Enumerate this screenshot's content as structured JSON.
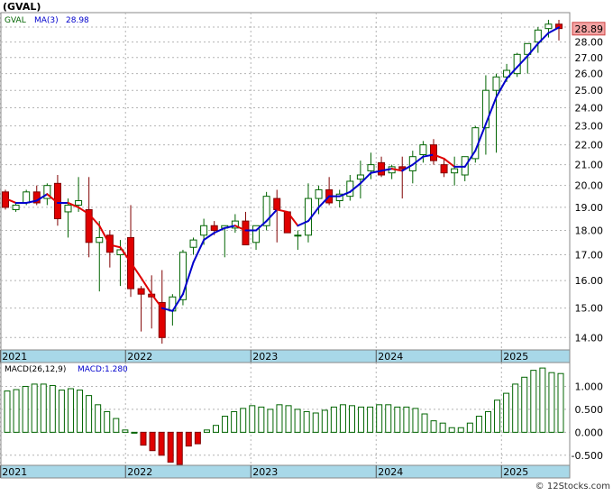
{
  "title": "(GVAL)",
  "watermark": "© 12Stocks.com",
  "colors": {
    "up_fill": "#ffffff",
    "up_stroke": "#006400",
    "down_fill": "#e00000",
    "down_stroke": "#800000",
    "ma_up": "#0000cc",
    "ma_down": "#e00000",
    "macd_pos_stroke": "#006400",
    "macd_neg_fill": "#e00000",
    "grid": "#b4b4b4",
    "axis_band": "#a8d8e8",
    "price_tag_bg": "#f4a4a4"
  },
  "chart_data": [
    {
      "type": "candlestick",
      "legend": {
        "symbol": "GVAL",
        "ma_label": "MA(3)",
        "ma_value": "28.98"
      },
      "last_price_label": "28.89",
      "ylim": [
        13.6,
        30.0
      ],
      "log_scale": true,
      "grid": true,
      "y_ticks": [
        14,
        15,
        16,
        17,
        18,
        19,
        20,
        21,
        22,
        23,
        24,
        25,
        26,
        27,
        28,
        29
      ],
      "y_tick_labels": [
        "14.00",
        "15.00",
        "16.00",
        "17.00",
        "18.00",
        "19.00",
        "20.00",
        "21.00",
        "22.00",
        "23.00",
        "24.00",
        "25.00",
        "26.00",
        "27.00",
        "28.00",
        "29.00"
      ],
      "x_labels": [
        "2021",
        "2022",
        "2023",
        "2024",
        "2025"
      ],
      "x_label_index": [
        0,
        12,
        24,
        36,
        48
      ],
      "ohlc": [
        [
          19.7,
          19.8,
          18.9,
          19.0
        ],
        [
          18.9,
          19.2,
          18.8,
          19.1
        ],
        [
          19.2,
          19.8,
          19.1,
          19.7
        ],
        [
          19.7,
          20.0,
          19.1,
          19.2
        ],
        [
          19.4,
          20.1,
          19.1,
          20.0
        ],
        [
          20.1,
          20.5,
          18.2,
          18.5
        ],
        [
          18.8,
          19.4,
          17.7,
          19.1
        ],
        [
          19.1,
          20.4,
          18.8,
          19.3
        ],
        [
          18.9,
          20.4,
          16.9,
          17.5
        ],
        [
          17.5,
          18.4,
          15.6,
          17.7
        ],
        [
          17.8,
          18.0,
          16.5,
          17.1
        ],
        [
          17.0,
          17.6,
          15.8,
          17.2
        ],
        [
          17.7,
          19.1,
          15.4,
          15.7
        ],
        [
          15.7,
          15.8,
          14.2,
          15.5
        ],
        [
          15.5,
          16.2,
          14.3,
          15.4
        ],
        [
          15.2,
          16.4,
          13.8,
          14.0
        ],
        [
          14.9,
          15.5,
          14.4,
          15.4
        ],
        [
          15.3,
          17.2,
          15.1,
          17.1
        ],
        [
          17.3,
          17.7,
          17.0,
          17.6
        ],
        [
          17.8,
          18.5,
          17.4,
          18.2
        ],
        [
          18.2,
          18.4,
          17.8,
          18.0
        ],
        [
          18.1,
          18.2,
          16.9,
          18.2
        ],
        [
          18.1,
          18.7,
          17.9,
          18.4
        ],
        [
          18.4,
          18.8,
          17.7,
          17.4
        ],
        [
          17.5,
          18.1,
          17.2,
          18.2
        ],
        [
          18.2,
          19.7,
          18.0,
          19.5
        ],
        [
          19.4,
          19.8,
          17.5,
          18.9
        ],
        [
          18.8,
          18.7,
          17.9,
          17.9
        ],
        [
          17.8,
          18.0,
          17.2,
          17.8
        ],
        [
          17.8,
          20.1,
          17.5,
          19.4
        ],
        [
          19.4,
          20.0,
          18.7,
          19.8
        ],
        [
          19.8,
          20.4,
          19.1,
          19.2
        ],
        [
          19.3,
          19.8,
          19.0,
          19.6
        ],
        [
          19.5,
          20.5,
          19.3,
          20.2
        ],
        [
          20.3,
          21.2,
          19.4,
          20.5
        ],
        [
          20.7,
          21.6,
          20.3,
          21.0
        ],
        [
          21.1,
          21.4,
          20.4,
          20.5
        ],
        [
          20.6,
          21.0,
          20.3,
          20.9
        ],
        [
          20.9,
          21.4,
          19.4,
          20.8
        ],
        [
          20.7,
          21.7,
          20.1,
          21.4
        ],
        [
          21.5,
          22.2,
          21.1,
          22.0
        ],
        [
          22.0,
          22.3,
          21.0,
          21.2
        ],
        [
          21.0,
          21.3,
          20.4,
          20.6
        ],
        [
          20.6,
          21.4,
          20.0,
          20.8
        ],
        [
          20.5,
          21.4,
          20.2,
          21.4
        ],
        [
          21.3,
          23.0,
          21.1,
          22.9
        ],
        [
          22.9,
          25.9,
          21.5,
          25.0
        ],
        [
          25.0,
          26.0,
          21.6,
          25.8
        ],
        [
          25.8,
          26.6,
          25.5,
          26.2
        ],
        [
          26.0,
          27.3,
          25.8,
          27.2
        ],
        [
          27.2,
          27.9,
          26.0,
          27.9
        ],
        [
          28.0,
          29.0,
          27.3,
          28.8
        ],
        [
          28.9,
          29.5,
          28.3,
          29.2
        ],
        [
          29.2,
          29.5,
          28.1,
          28.9
        ]
      ],
      "ma3": [
        19.4,
        19.2,
        19.2,
        19.3,
        19.6,
        19.2,
        19.2,
        19.0,
        18.7,
        18.2,
        17.4,
        17.3,
        16.7,
        16.1,
        15.5,
        15.0,
        14.9,
        15.5,
        16.7,
        17.6,
        17.9,
        18.1,
        18.2,
        18.0,
        18.0,
        18.4,
        18.9,
        18.8,
        18.2,
        18.4,
        19.0,
        19.5,
        19.5,
        19.7,
        20.1,
        20.6,
        20.7,
        20.8,
        20.7,
        21.0,
        21.4,
        21.5,
        21.3,
        20.9,
        20.9,
        21.7,
        23.1,
        24.6,
        25.7,
        26.4,
        27.1,
        27.9,
        28.6,
        28.98
      ],
      "ma_trend_down": [
        true,
        true,
        false,
        false,
        false,
        true,
        false,
        true,
        true,
        true,
        true,
        true,
        true,
        true,
        true,
        true,
        false,
        false,
        false,
        false,
        false,
        false,
        false,
        true,
        false,
        false,
        false,
        true,
        true,
        false,
        false,
        false,
        false,
        false,
        false,
        false,
        false,
        false,
        true,
        false,
        false,
        false,
        true,
        true,
        false,
        false,
        false,
        false,
        false,
        false,
        false,
        false,
        false,
        false
      ]
    },
    {
      "type": "bar",
      "legend": {
        "label": "MACD(26,12,9)",
        "value_label": "MACD:1.280"
      },
      "ylim": [
        -0.72,
        1.52
      ],
      "grid": true,
      "y_ticks": [
        -0.5,
        0,
        0.5,
        1.0
      ],
      "y_tick_labels": [
        "-0.500",
        "0.000",
        "0.500",
        "1.000"
      ],
      "x_labels": [
        "2021",
        "2022",
        "2023",
        "2024",
        "2025"
      ],
      "values": [
        0.9,
        0.93,
        1.0,
        1.05,
        1.05,
        1.02,
        0.92,
        0.95,
        0.92,
        0.8,
        0.6,
        0.45,
        0.3,
        0.05,
        0.0,
        -0.28,
        -0.4,
        -0.5,
        -0.65,
        -0.7,
        -0.3,
        -0.25,
        0.05,
        0.15,
        0.35,
        0.45,
        0.52,
        0.58,
        0.55,
        0.5,
        0.6,
        0.58,
        0.5,
        0.45,
        0.42,
        0.48,
        0.55,
        0.6,
        0.58,
        0.55,
        0.55,
        0.6,
        0.6,
        0.55,
        0.55,
        0.52,
        0.4,
        0.25,
        0.2,
        0.1,
        0.1,
        0.2,
        0.35,
        0.45,
        0.7,
        0.85,
        1.05,
        1.2,
        1.35,
        1.4,
        1.3,
        1.28
      ]
    }
  ]
}
